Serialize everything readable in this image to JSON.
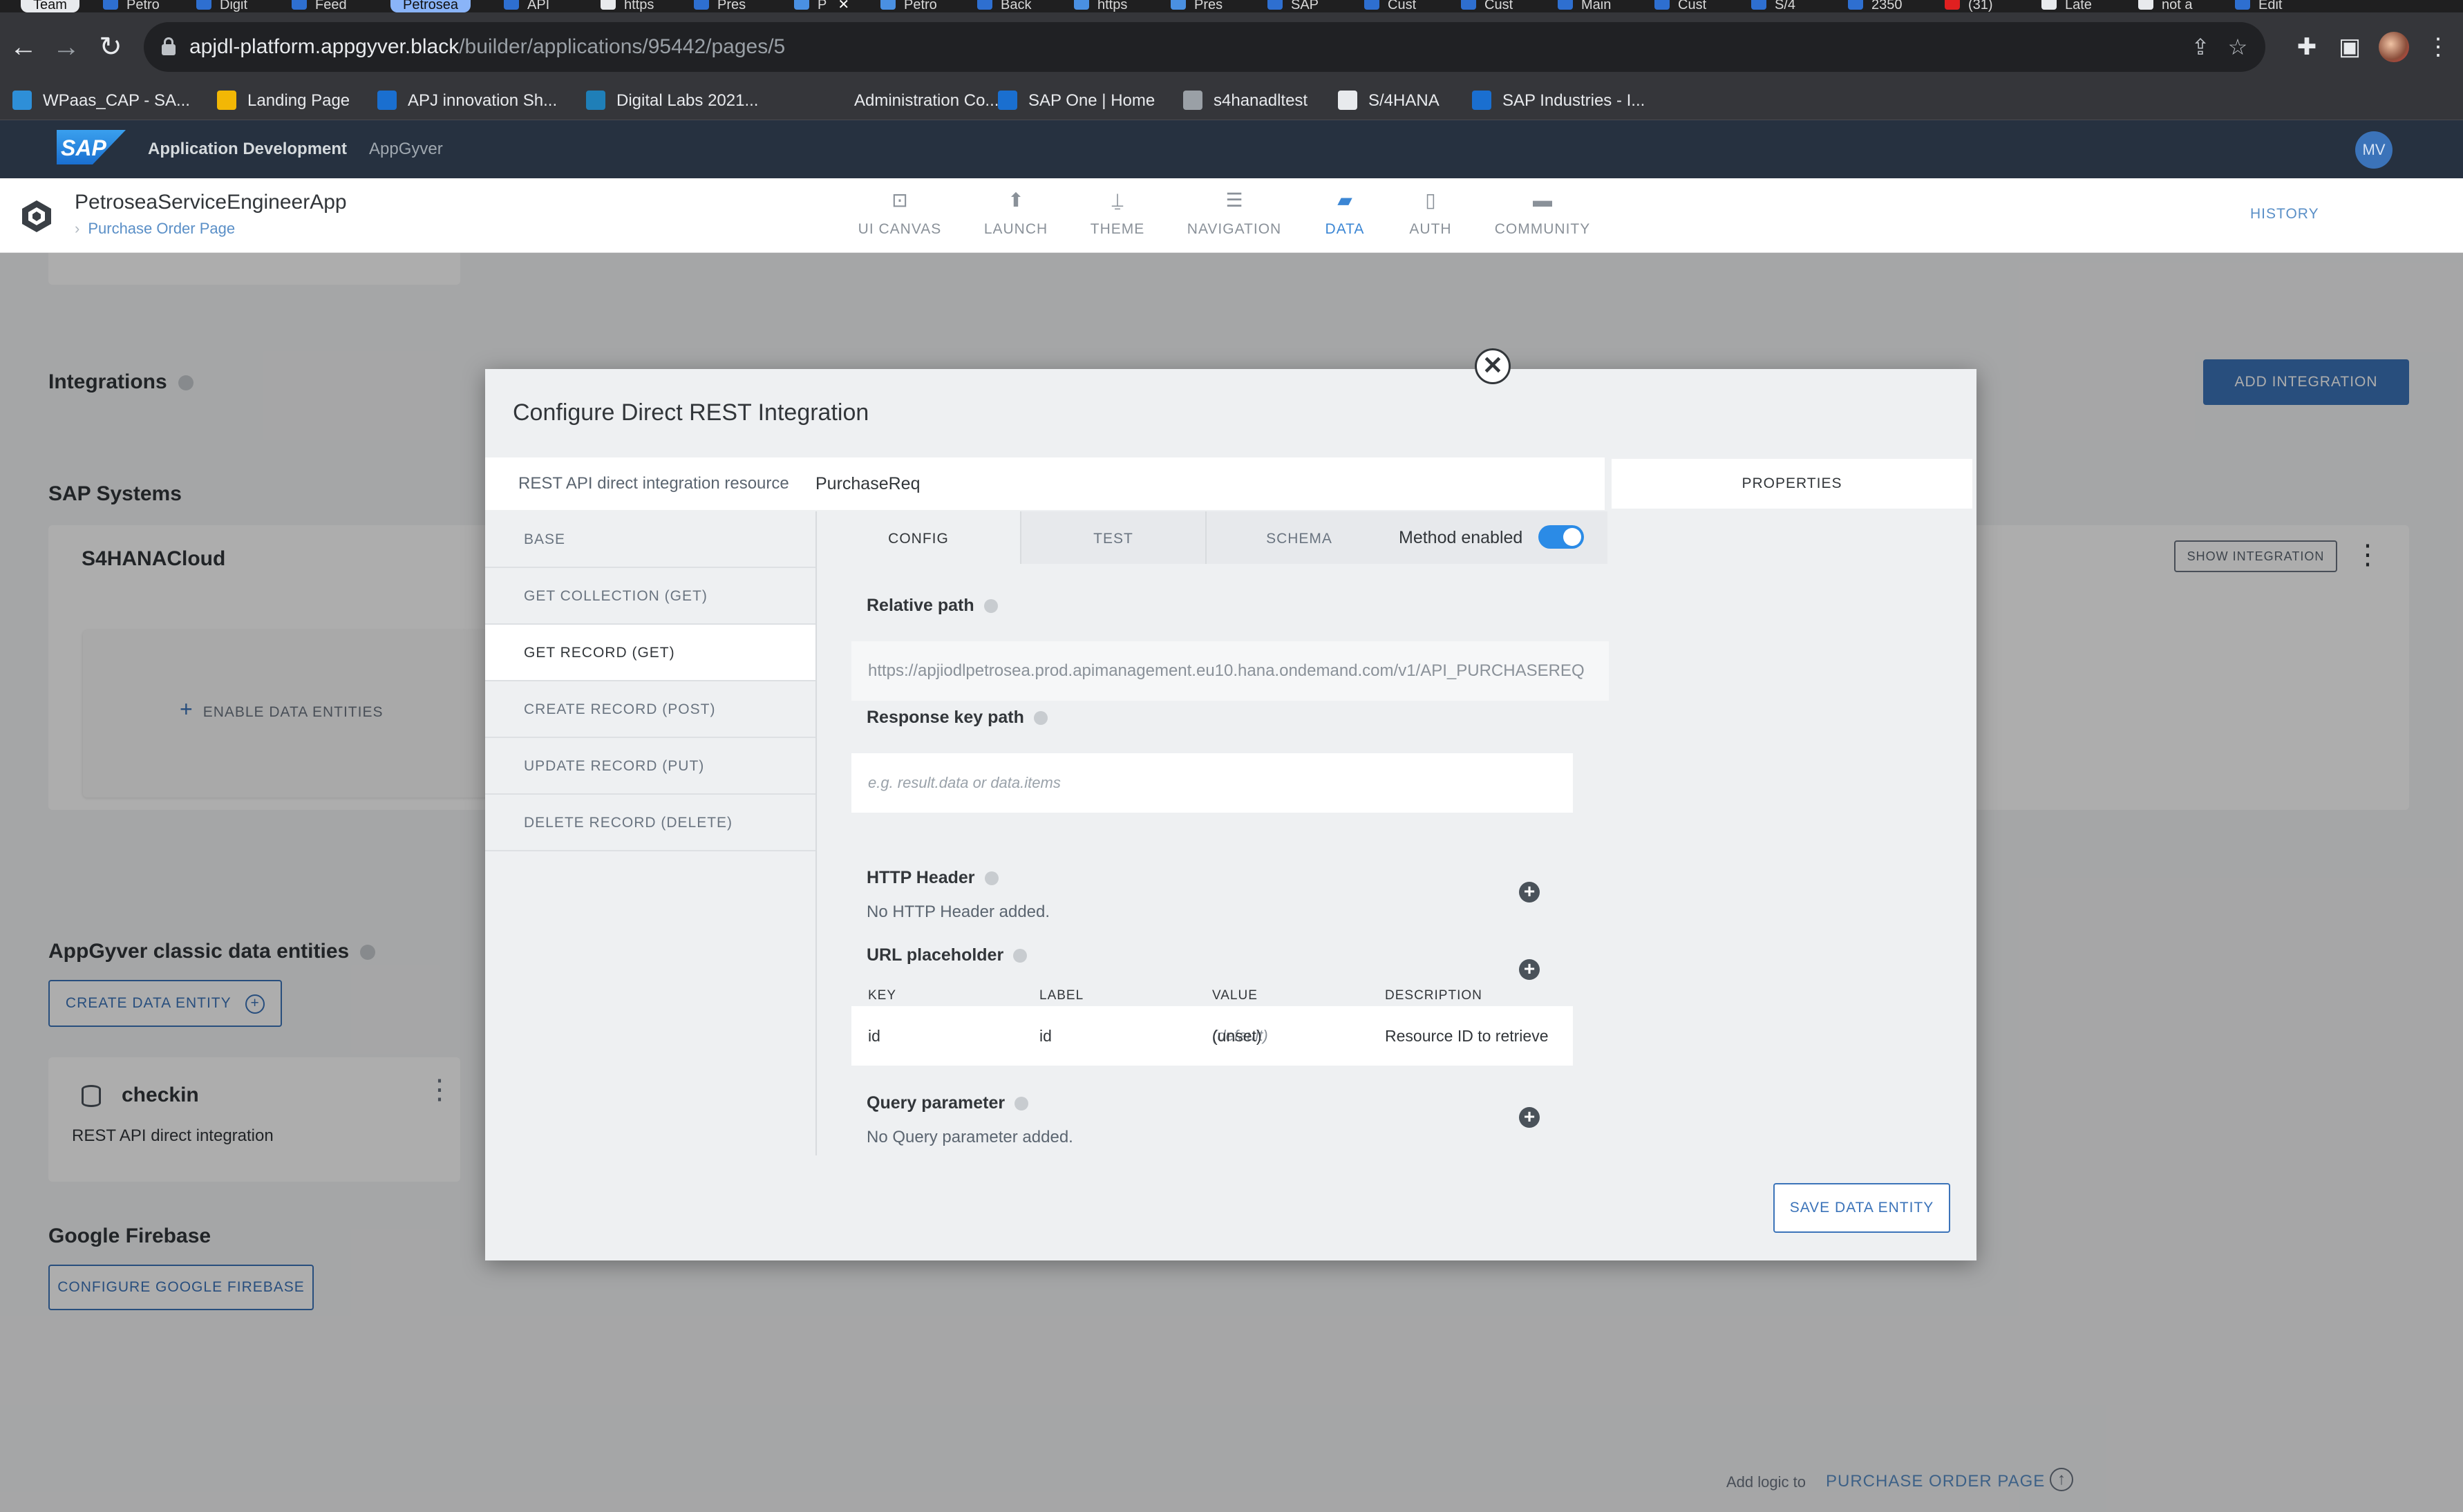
{
  "browser": {
    "tabs": [
      {
        "label": "Team",
        "kind": "pill-grey"
      },
      {
        "label": "Petro",
        "kind": "tab"
      },
      {
        "label": "Digit",
        "kind": "tab"
      },
      {
        "label": "Feed",
        "kind": "tab"
      },
      {
        "label": "Petrosea",
        "kind": "pill-blue"
      },
      {
        "label": "API",
        "kind": "tab"
      },
      {
        "label": "https",
        "kind": "tab"
      },
      {
        "label": "Pres",
        "kind": "tab"
      },
      {
        "label": "P",
        "kind": "tab-active"
      },
      {
        "label": "Petro",
        "kind": "tab"
      },
      {
        "label": "Back",
        "kind": "tab"
      },
      {
        "label": "https",
        "kind": "tab"
      },
      {
        "label": "Pres",
        "kind": "tab"
      },
      {
        "label": "SAP",
        "kind": "tab"
      },
      {
        "label": "Cust",
        "kind": "tab"
      },
      {
        "label": "Cust",
        "kind": "tab"
      },
      {
        "label": "Main",
        "kind": "tab"
      },
      {
        "label": "Cust",
        "kind": "tab"
      },
      {
        "label": "S/4",
        "kind": "tab"
      },
      {
        "label": "2350",
        "kind": "tab"
      },
      {
        "label": "(31)",
        "kind": "tab"
      },
      {
        "label": "Late",
        "kind": "tab"
      },
      {
        "label": "not a",
        "kind": "tab"
      },
      {
        "label": "Edit",
        "kind": "tab"
      }
    ],
    "url_host": "apjdl-platform.appgyver.black",
    "url_path": "/builder/applications/95442/pages/5",
    "icons": {
      "back": "back-arrow-icon",
      "forward": "forward-arrow-icon",
      "reload": "reload-icon",
      "lock": "lock-icon",
      "share": "share-icon",
      "star": "bookmark-star-icon",
      "extensions": "puzzle-icon",
      "sidebar": "side-panel-icon",
      "menu": "kebab-menu-icon"
    },
    "bookmarks": [
      {
        "label": "WPaas_CAP - SA...",
        "color": "#2e8fd8"
      },
      {
        "label": "Landing Page",
        "color": "#f2b705"
      },
      {
        "label": "APJ innovation Sh...",
        "color": "#1a6fd0"
      },
      {
        "label": "Digital Labs 2021...",
        "color": "#1f7fb8"
      },
      {
        "label": "Administration Co...",
        "color": "#35363a"
      },
      {
        "label": "SAP One | Home",
        "color": "#1a6fd0"
      },
      {
        "label": "s4hanadltest",
        "color": "#9aa0a6"
      },
      {
        "label": "S/4HANA",
        "color": "#e8eaed"
      },
      {
        "label": "SAP Industries - I...",
        "color": "#1a6fd0"
      }
    ]
  },
  "shell": {
    "logo_text": "SAP",
    "title": "Application Development",
    "subtitle": "AppGyver",
    "avatar": "MV"
  },
  "appbar": {
    "app_name": "PetroseaServiceEngineerApp",
    "breadcrumb": "Purchase Order Page",
    "nav": [
      {
        "label": "UI CANVAS",
        "icon": "canvas-icon",
        "glyph": "⊡",
        "active": false
      },
      {
        "label": "LAUNCH",
        "icon": "launch-icon",
        "glyph": "⬆",
        "active": false
      },
      {
        "label": "THEME",
        "icon": "brush-icon",
        "glyph": "⍊",
        "active": false
      },
      {
        "label": "NAVIGATION",
        "icon": "list-icon",
        "glyph": "☰",
        "active": false
      },
      {
        "label": "DATA",
        "icon": "folder-icon",
        "glyph": "▰",
        "active": true
      },
      {
        "label": "AUTH",
        "icon": "auth-document-icon",
        "glyph": "▯",
        "active": false
      },
      {
        "label": "COMMUNITY",
        "icon": "chat-icon",
        "glyph": "▬",
        "active": false
      }
    ],
    "history": "HISTORY"
  },
  "page": {
    "integrations_title": "Integrations",
    "add_integration": "ADD INTEGRATION",
    "sap_systems_title": "SAP Systems",
    "system_name": "S4HANACloud",
    "show_integration": "SHOW INTEGRATION",
    "enable_data_entities": "ENABLE DATA ENTITIES",
    "classic_title": "AppGyver classic data entities",
    "create_data_entity": "CREATE DATA ENTITY",
    "entity_name": "checkin",
    "entity_type": "REST API direct integration",
    "firebase_title": "Google Firebase",
    "configure_firebase": "CONFIGURE GOOGLE FIREBASE",
    "bottom_add_logic": "Add logic to",
    "bottom_page": "PURCHASE ORDER PAGE"
  },
  "modal": {
    "title": "Configure Direct REST Integration",
    "resource_label": "REST API direct integration resource",
    "resource_name": "PurchaseReq",
    "properties": "PROPERTIES",
    "methods": [
      {
        "label": "BASE",
        "active": false
      },
      {
        "label": "GET COLLECTION (GET)",
        "active": false
      },
      {
        "label": "GET RECORD (GET)",
        "active": true
      },
      {
        "label": "CREATE RECORD (POST)",
        "active": false
      },
      {
        "label": "UPDATE RECORD (PUT)",
        "active": false
      },
      {
        "label": "DELETE RECORD (DELETE)",
        "active": false
      }
    ],
    "tabs": [
      {
        "label": "CONFIG",
        "active": true
      },
      {
        "label": "TEST",
        "active": false
      },
      {
        "label": "SCHEMA",
        "active": false
      }
    ],
    "method_enabled_label": "Method enabled",
    "method_enabled": true,
    "relative_path_label": "Relative path",
    "relative_path_value": "https://apjiodlpetrosea.prod.apimanagement.eu10.hana.ondemand.com/v1/API_PURCHASEREQ",
    "response_key_label": "Response key path",
    "response_key_placeholder": "e.g. result.data or data.items",
    "http_header_label": "HTTP Header",
    "http_header_empty": "No HTTP Header added.",
    "url_placeholder_label": "URL placeholder",
    "columns": {
      "key": "KEY",
      "label": "LABEL",
      "value": "VALUE",
      "description": "DESCRIPTION"
    },
    "placeholder_row": {
      "key": "id",
      "label": "id",
      "value_unset": "(unset)",
      "value_default": "(default)",
      "description": "Resource ID to retrieve"
    },
    "query_param_label": "Query parameter",
    "query_param_empty": "No Query parameter added.",
    "save": "SAVE DATA ENTITY",
    "close_glyph": "✕"
  }
}
